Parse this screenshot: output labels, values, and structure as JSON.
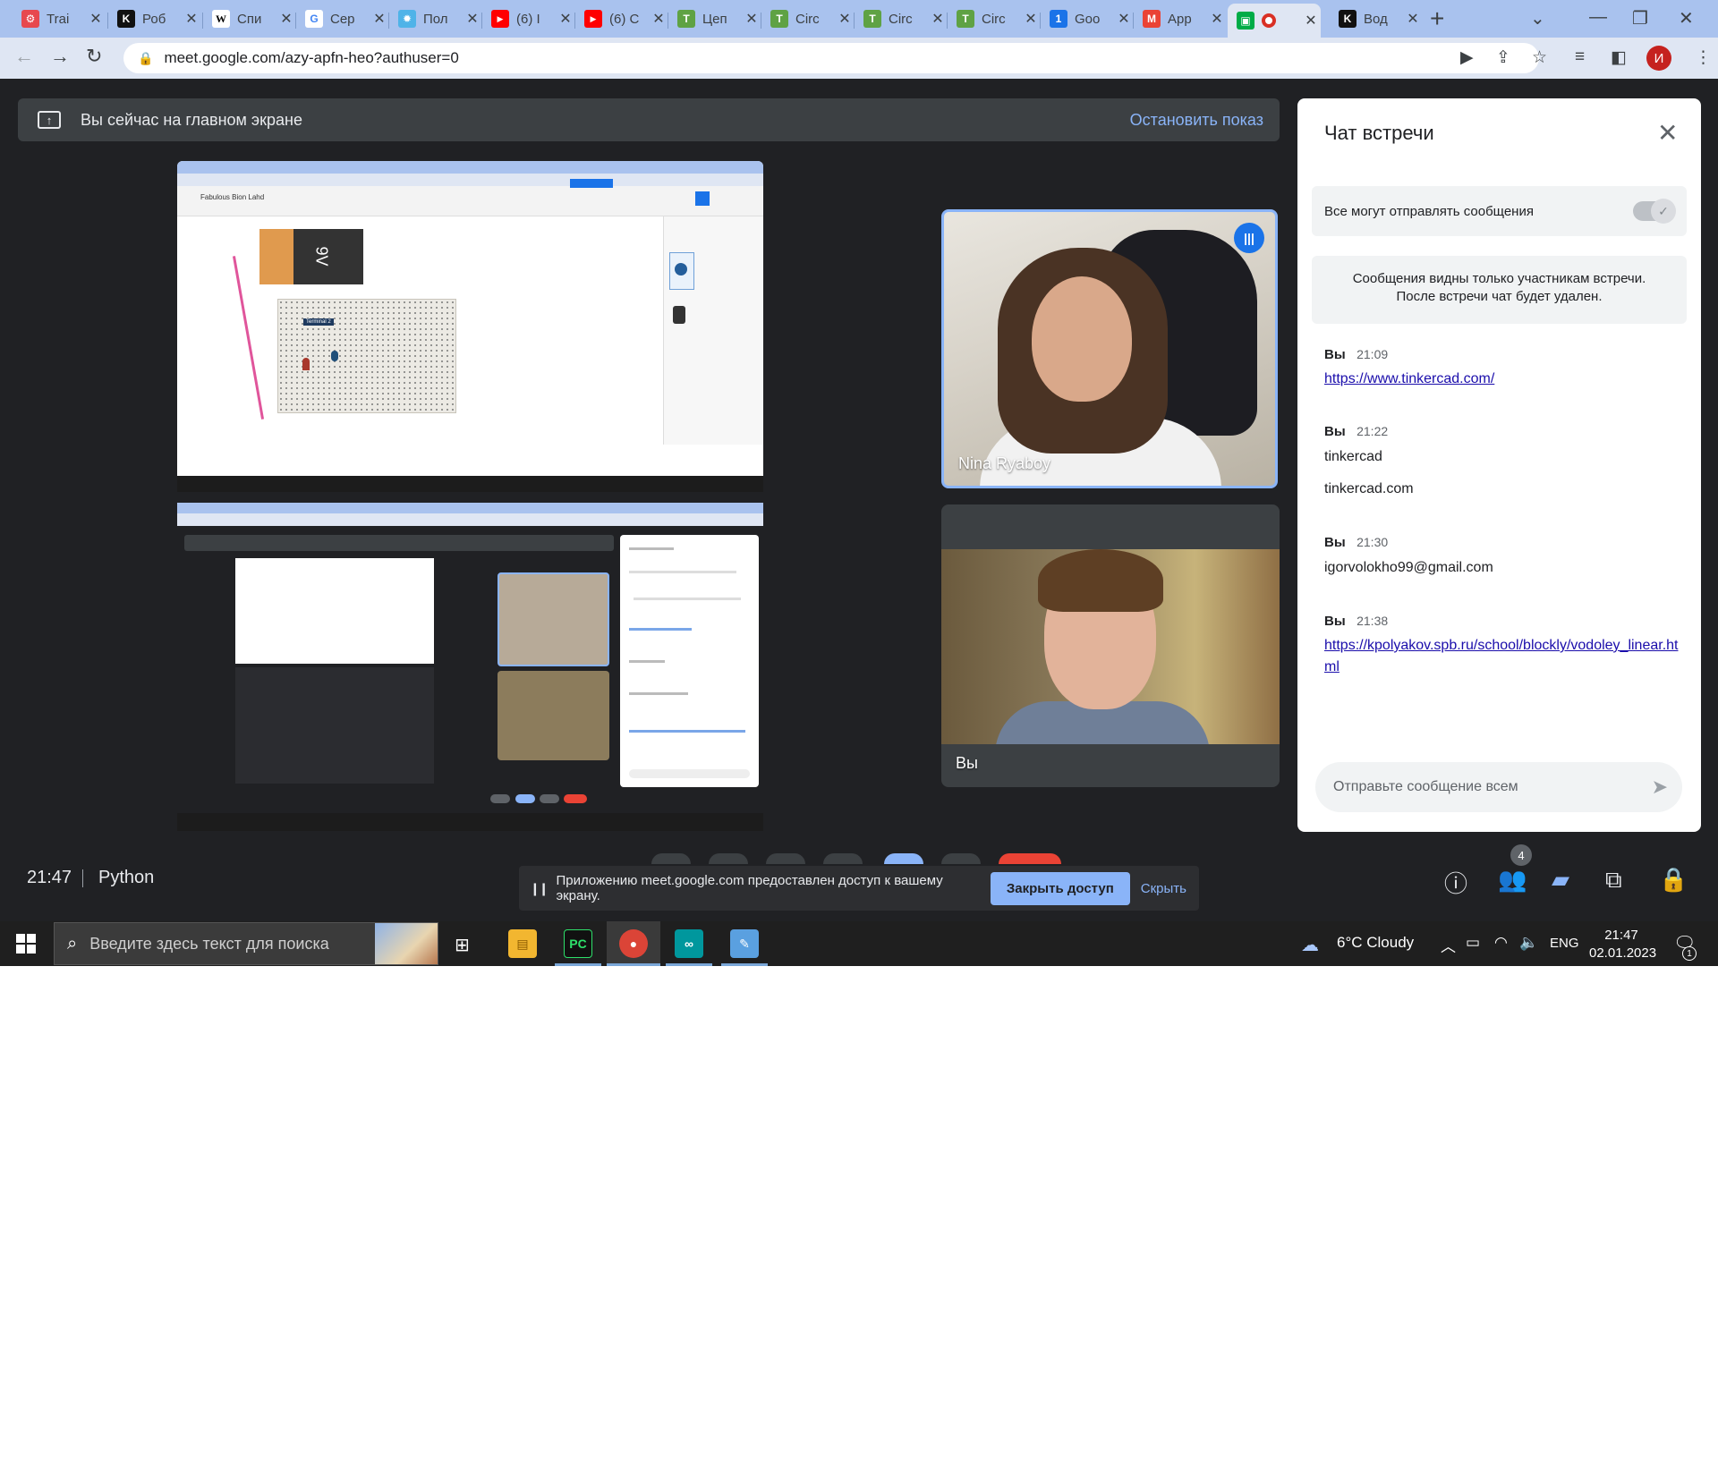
{
  "browser": {
    "tabs": [
      {
        "label": "Trai",
        "icon": "tinkercad-icon",
        "color": "#e7484e",
        "glyph": "⚙"
      },
      {
        "label": "Роб",
        "icon": "kpolyakov-icon",
        "color": "#111111",
        "glyph": "K"
      },
      {
        "label": "Спи",
        "icon": "wikipedia-icon",
        "color": "#ffffff",
        "glyph": "W"
      },
      {
        "label": "Сер",
        "icon": "google-icon",
        "color": "#ffffff",
        "glyph": "G"
      },
      {
        "label": "Пол",
        "icon": "snowflake-icon",
        "color": "#4fb3e8",
        "glyph": "✹"
      },
      {
        "label": "(6) I",
        "icon": "youtube-icon",
        "color": "#ff0000",
        "glyph": "▶"
      },
      {
        "label": "(6) С",
        "icon": "youtube-icon",
        "color": "#ff0000",
        "glyph": "▶"
      },
      {
        "label": "Цеп",
        "icon": "tinkercad-icon",
        "color": "#5fa244",
        "glyph": "T"
      },
      {
        "label": "Circ",
        "icon": "tinkercad-icon",
        "color": "#5fa244",
        "glyph": "T"
      },
      {
        "label": "Circ",
        "icon": "tinkercad-icon",
        "color": "#5fa244",
        "glyph": "T"
      },
      {
        "label": "Circ",
        "icon": "tinkercad-icon",
        "color": "#5fa244",
        "glyph": "T"
      },
      {
        "label": "Goo",
        "icon": "google-calendar-icon",
        "color": "#1a73e8",
        "glyph": "1"
      },
      {
        "label": "App",
        "icon": "gmail-icon",
        "color": "#ea4335",
        "glyph": "M"
      },
      {
        "label": "",
        "icon": "google-meet-icon",
        "color": "#00ac47",
        "glyph": "▣",
        "active": true
      },
      {
        "label": "Вод",
        "icon": "kpolyakov-icon",
        "color": "#111111",
        "glyph": "K"
      }
    ],
    "url": "meet.google.com/azy-apfn-heo?authuser=0",
    "profile_initial": "И"
  },
  "banner": {
    "text": "Вы сейчас на главном экране",
    "stop_label": "Остановить показ"
  },
  "shared_screen": {
    "project_title": "Fabulous Bion Lahd",
    "battery_label": "9V",
    "terminal_label": "Terminal 2"
  },
  "participants": [
    {
      "name": "Nina Ryaboy",
      "speaking": true
    },
    {
      "name": "Вы",
      "speaking": false
    }
  ],
  "chat": {
    "title": "Чат встречи",
    "toggle_label": "Все могут отправлять сообщения",
    "toggle_on": true,
    "note_line1": "Сообщения видны только участникам встречи.",
    "note_line2": "После встречи чат будет удален.",
    "messages": [
      {
        "author": "Вы",
        "time": "21:09",
        "lines": [
          "https://www.tinkercad.com/"
        ],
        "link": true
      },
      {
        "author": "Вы",
        "time": "21:22",
        "lines": [
          "tinkercad",
          "tinkercad.com"
        ],
        "link": false
      },
      {
        "author": "Вы",
        "time": "21:30",
        "lines": [
          "igorvolokho99@gmail.com"
        ],
        "link": false
      },
      {
        "author": "Вы",
        "time": "21:38",
        "lines": [
          "https://kpolyakov.spb.ru/school/blockly/vodoley_linear.html"
        ],
        "link": true
      }
    ],
    "input_placeholder": "Отправьте сообщение всем"
  },
  "meeting": {
    "time": "21:47",
    "name": "Python",
    "participants_count": "4",
    "share_notice": "Приложению meet.google.com предоставлен доступ к вашему экрану.",
    "close_access_label": "Закрыть доступ",
    "hide_label": "Скрыть"
  },
  "taskbar": {
    "search_placeholder": "Введите здесь текст для поиска",
    "weather": "6°C  Cloudy",
    "language": "ENG",
    "clock_time": "21:47",
    "clock_date": "02.01.2023",
    "notification_count": "1"
  },
  "colors": {
    "meet_bg": "#202124",
    "accent": "#8ab4f8",
    "tabstrip": "#a9c2ee",
    "link": "#1a0dab"
  }
}
